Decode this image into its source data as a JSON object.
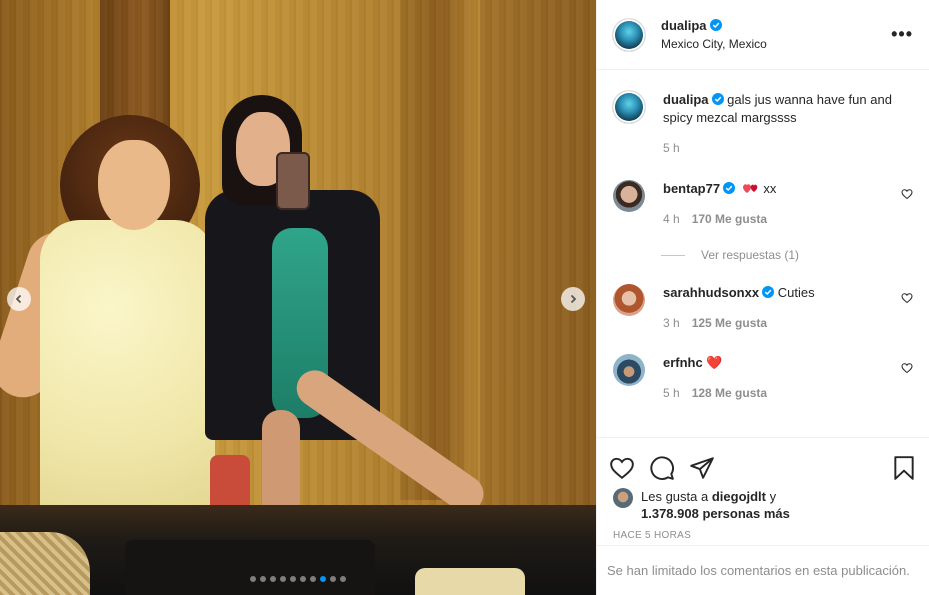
{
  "post": {
    "username": "dualipa",
    "location": "Mexico City, Mexico",
    "caption": "gals jus wanna have fun and spicy mezcal margssss",
    "caption_time": "5 h",
    "carousel": {
      "count": 10,
      "active_index": 7
    }
  },
  "comments": [
    {
      "username": "bentap77",
      "verified": true,
      "text": "xx",
      "emoji": "two-hearts",
      "time": "4 h",
      "likes": "170 Me gusta",
      "replies": "Ver respuestas (1)"
    },
    {
      "username": "sarahhudsonxx",
      "verified": true,
      "text": "Cuties",
      "time": "3 h",
      "likes": "125 Me gusta"
    },
    {
      "username": "erfnhc",
      "verified": false,
      "text": "❤️",
      "time": "5 h",
      "likes": "128 Me gusta"
    }
  ],
  "likes": {
    "prefix": "Les gusta a",
    "user": "diegojdlt",
    "connector": "y",
    "count": "1.378.908 personas más"
  },
  "timestamp": "HACE 5 HORAS",
  "comments_limited": "Se han limitado los comentarios en esta publicación.",
  "colors": {
    "verified": "#0095f6",
    "heart": "#ed4956",
    "muted": "#8e8e8e"
  },
  "icons": [
    "more-options-icon",
    "heart-icon",
    "comment-icon",
    "share-icon",
    "bookmark-icon",
    "chevron-left-icon",
    "chevron-right-icon",
    "verified-badge-icon"
  ]
}
